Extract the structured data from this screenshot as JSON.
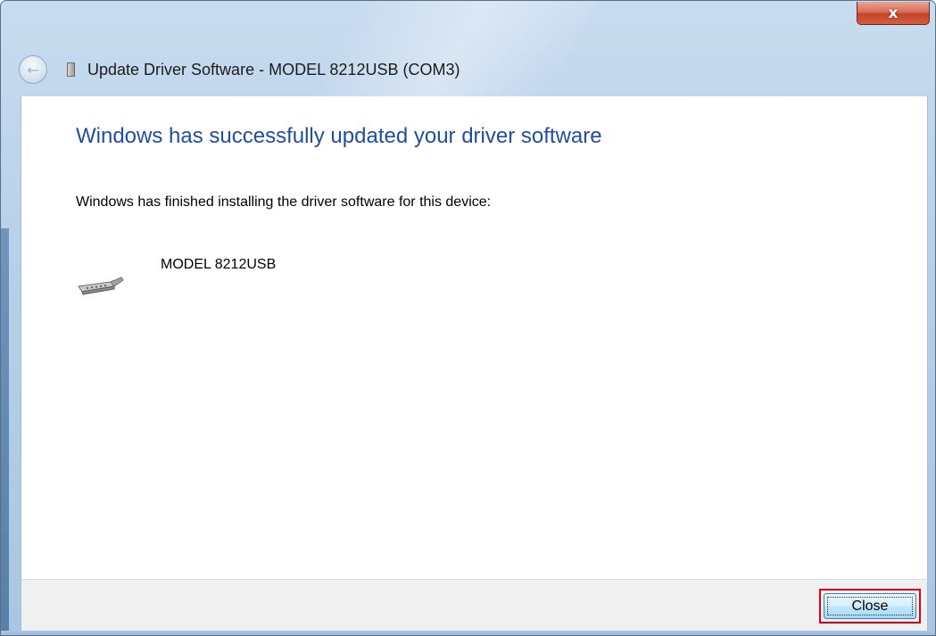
{
  "window": {
    "title": "Update Driver Software - MODEL 8212USB (COM3)",
    "close_glyph": "x"
  },
  "content": {
    "heading": "Windows has successfully updated your driver software",
    "message": "Windows has finished installing the driver software for this device:",
    "device_name": "MODEL 8212USB"
  },
  "footer": {
    "close_label": "Close"
  },
  "icons": {
    "back": "back-arrow-icon",
    "title_device": "device-icon",
    "device": "serial-port-icon"
  },
  "colors": {
    "heading": "#1f4ea3",
    "highlight": "#e0001a"
  }
}
